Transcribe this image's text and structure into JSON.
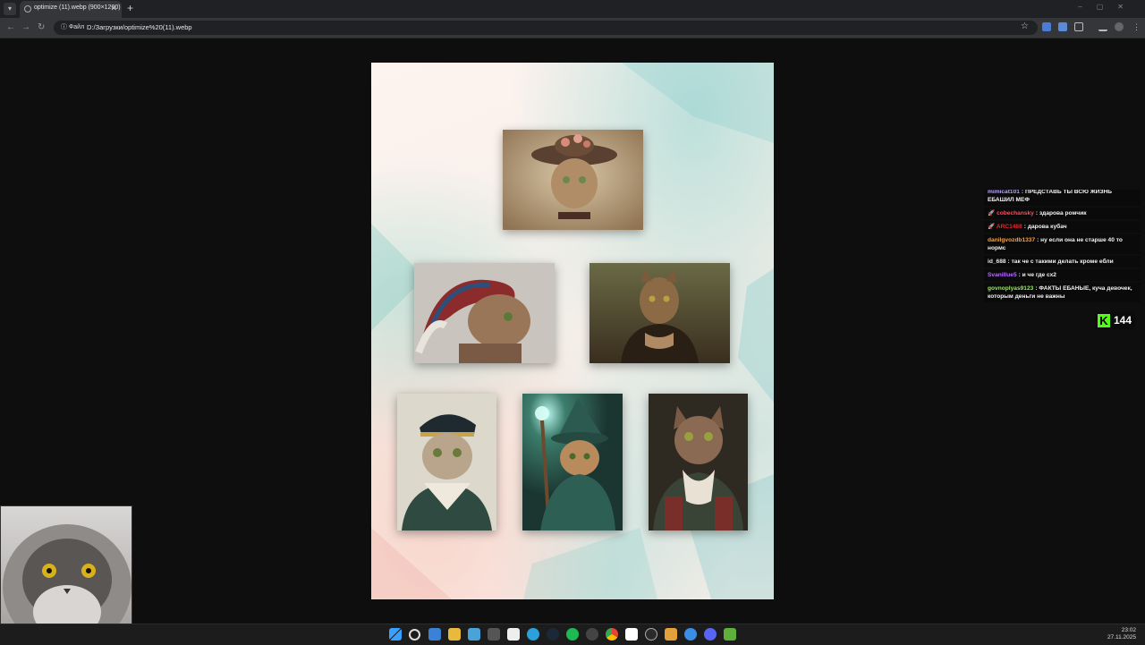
{
  "browser": {
    "tab_title": "optimize (11).webp (900×1200)",
    "tab_close": "✕",
    "new_tab": "+",
    "menu_glyph": "▾",
    "back_glyph": "←",
    "forward_glyph": "→",
    "reload_glyph": "↻",
    "site_chip": "ⓘ Файл",
    "url": "D:/Загрузки/optimize%20(11).webp",
    "bookmark_glyph": "☆",
    "window_controls": "–▢✕"
  },
  "image": {
    "cards": [
      {
        "name": "cat-flower-hat",
        "colors": [
          "#c9b497",
          "#7a5c3e"
        ]
      },
      {
        "name": "cat-headdress",
        "colors": [
          "#cfcac4",
          "#8a6b55"
        ]
      },
      {
        "name": "cat-mona-lisa",
        "colors": [
          "#5e5a3a",
          "#3a2a1d"
        ]
      },
      {
        "name": "cat-captain",
        "colors": [
          "#d8d3c6",
          "#33423a"
        ]
      },
      {
        "name": "cat-wizard",
        "colors": [
          "#2c5a4d",
          "#1f3e38"
        ]
      },
      {
        "name": "cat-aristocrat",
        "colors": [
          "#2f2b24",
          "#6b4a37"
        ]
      }
    ]
  },
  "chat": {
    "messages": [
      {
        "user": "mimicat101",
        "user_color": "#b9a3ff",
        "text": "ПРЕДСТАВЬ ТЫ ВСЮ ЖИЗНЬ ЕБАШИЛ МЕФ",
        "badge": ""
      },
      {
        "user": "cobechansky",
        "user_color": "#ff4a5c",
        "text": "здарова ромчик",
        "badge": "🚀"
      },
      {
        "user": "ARC1488",
        "user_color": "#e0282e",
        "text": "дарова кубач",
        "badge": "🚀"
      },
      {
        "user": "danilgvozdb1337",
        "user_color": "#f3a34c",
        "text": "ну если она не старше 40 то нормс",
        "badge": ""
      },
      {
        "user": "id_688",
        "user_color": "#e8e8e8",
        "text": "так че с такими делать кроме ебли",
        "badge": ""
      },
      {
        "user": "Svanillue5",
        "user_color": "#b86dff",
        "text": "и че где сх2",
        "badge": ""
      },
      {
        "user": "govnoplyas9123",
        "user_color": "#9de36b",
        "text": "ФАКТЫ ЕБАНЫЕ, куча девочек, которым деньги не важны",
        "badge": ""
      }
    ]
  },
  "kick": {
    "logo": "K",
    "viewers": "144"
  },
  "taskbar": {
    "icons": [
      "windows-start-icon",
      "search-icon",
      "widgets-icon",
      "file-explorer-icon",
      "photos-icon",
      "terminal-icon",
      "calendar-icon",
      "telegram-icon",
      "steam-icon",
      "spotify-icon",
      "github-icon",
      "chrome-icon",
      "x-icon",
      "obs-icon",
      "app-icon",
      "edge-icon",
      "discord-icon",
      "minecraft-icon"
    ],
    "time": "23:02",
    "date": "27.11.2025"
  }
}
